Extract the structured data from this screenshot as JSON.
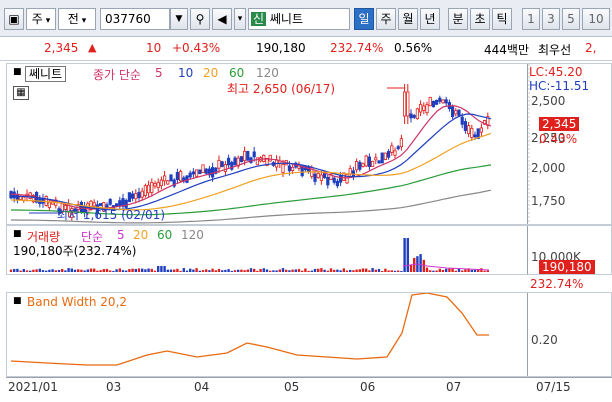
{
  "toolbar": {
    "market_type": "주",
    "market_all": "전",
    "stock_code": "037760",
    "stock_badge": "신",
    "stock_name": "쎄니트",
    "period_tabs": [
      "일",
      "주",
      "월",
      "년",
      "분",
      "초",
      "틱"
    ],
    "selected_period": "일",
    "minute_options": [
      "1",
      "3",
      "5",
      "10"
    ]
  },
  "info": {
    "price": "2,345",
    "change": "10",
    "change_pct": "+0.43%",
    "volume": "190,180",
    "volume_ratio": "232.74%",
    "turnover": "0.56%",
    "amount": "444백만",
    "preferred_label": "최우선",
    "preferred_value": "2,",
    "up_color": "#e0201c"
  },
  "price_panel": {
    "legend_name": "쎄니트",
    "legend_ma": "종가 단순",
    "ma_periods": [
      "5",
      "10",
      "20",
      "60",
      "120"
    ],
    "ma_colors": [
      "#cc3366",
      "#1f3fbf",
      "#f0a020",
      "#2a9d3a",
      "#888888"
    ],
    "lc_label": "LC:45.20",
    "hc_label": "HC:-11.51",
    "y_ticks": [
      "2,500",
      "2,250",
      "2,000",
      "1,750"
    ],
    "current_price": "2,345",
    "current_pct": "0.43%",
    "high_annotation": "최고 2,650 (06/17)",
    "low_annotation": "최저 1,615 (02/01)"
  },
  "volume_panel": {
    "legend_name": "거래량",
    "legend_ma": "단순",
    "ma_periods": [
      "5",
      "20",
      "60",
      "120"
    ],
    "current_info": "190,180주(232.74%)",
    "y_tick": "10,000K",
    "current_volume": "190,180",
    "current_pct": "232.74%"
  },
  "band_panel": {
    "legend": "Band Width 20,2",
    "y_tick": "0.20"
  },
  "x_axis": {
    "labels": [
      "2021/01",
      "03",
      "04",
      "05",
      "06",
      "07",
      "07/15"
    ]
  },
  "chart_data": [
    {
      "type": "candlestick",
      "title": "쎄니트",
      "x_range": [
        "2021/01",
        "2021/07/15"
      ],
      "ylim": [
        1615,
        2650
      ],
      "high": {
        "value": 2650,
        "date": "06/17"
      },
      "low": {
        "value": 1615,
        "date": "02/01"
      },
      "last_close": 2345,
      "ma_series": [
        "5",
        "10",
        "20",
        "60",
        "120"
      ]
    },
    {
      "type": "bar",
      "title": "거래량",
      "last_value": 190180,
      "last_ratio_pct": 232.74
    },
    {
      "type": "line",
      "title": "Band Width 20,2",
      "y_tick": 0.2
    }
  ]
}
